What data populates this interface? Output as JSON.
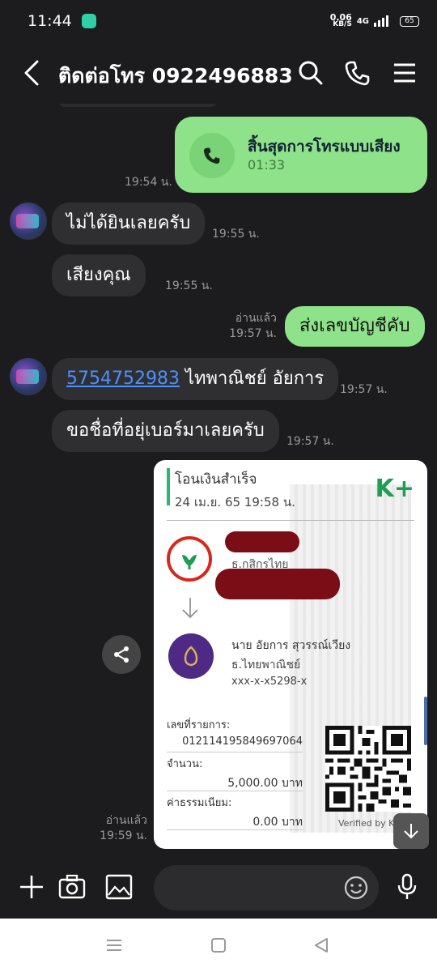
{
  "status_bar": {
    "time": "11:44",
    "net_speed_value": "0.06",
    "net_speed_unit": "KB/S",
    "network": "4G",
    "battery": "65"
  },
  "header": {
    "title": "ติดต่อโทร 0922496883",
    "icons": [
      "back-icon",
      "search-icon",
      "phone-icon",
      "menu-icon"
    ]
  },
  "messages": {
    "call": {
      "title": "สิ้นสุดการโทรแบบเสียง",
      "duration": "01:33",
      "time": "19:54 น."
    },
    "m1": {
      "text": "ไม่ได้ยินเลยครับ",
      "time": "19:55 น."
    },
    "m2": {
      "text": "เสียงคุณ",
      "time": "19:55 น."
    },
    "m3": {
      "text": "ส่งเลขบัญชีคับ",
      "read": "อ่านแล้ว",
      "time": "19:57 น."
    },
    "m4": {
      "link": "5754752983",
      "text": " ไทพาณิชย์ อัยการ",
      "time": "19:57 น."
    },
    "m5": {
      "text": "ขอชื่อที่อยุ่เบอร์มาเลยครับ",
      "time": "19:57 น."
    },
    "slip_msg": {
      "read": "อ่านแล้ว",
      "time": "19:59 น."
    }
  },
  "slip": {
    "title": "โอนเงินสำเร็จ",
    "date": "24 เม.ย. 65  19:58 น.",
    "brand": "K+",
    "from_bank": "ธ.กสิกรไทย",
    "to_name": "นาย อัยการ สุวรรณ์เวียง",
    "to_bank": "ธ.ไทยพาณิชย์",
    "to_account": "xxx-x-x5298-x",
    "ref_label": "เลขที่รายการ:",
    "ref_value": "012114195849697064",
    "amount_label": "จำนวน:",
    "amount_value": "5,000.00 บาท",
    "fee_label": "ค่าธรรมเนียม:",
    "fee_value": "0.00 บาท",
    "verified": "Verified by K+"
  },
  "input": {
    "placeholder": ""
  },
  "colors": {
    "bg": "#1c1c1e",
    "in_bubble": "#2f2f31",
    "out_bubble": "#8ee28a",
    "link": "#4a90ff",
    "kbank_green": "#1e9e52"
  }
}
